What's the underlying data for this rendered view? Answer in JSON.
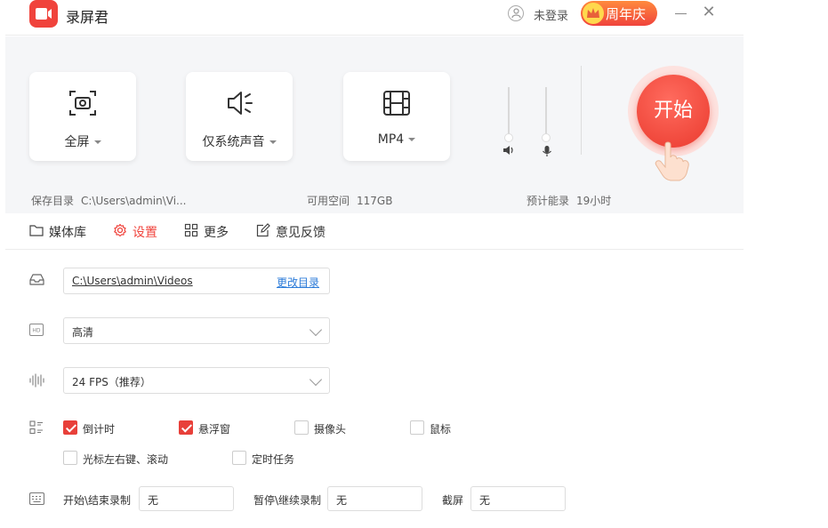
{
  "titlebar": {
    "app_title": "录屏君",
    "user_label": "未登录",
    "anniversary_label": "周年庆"
  },
  "controls": {
    "capture_area": "全屏",
    "audio_source": "仅系统声音",
    "format": "MP4",
    "start_label": "开始"
  },
  "info": {
    "save_dir_label": "保存目录",
    "save_dir_value": "C:\\Users\\admin\\Vi...",
    "free_space_label": "可用空间",
    "free_space_value": "117GB",
    "estimate_label": "预计能录",
    "estimate_value": "19小时"
  },
  "tabs": [
    {
      "label": "媒体库"
    },
    {
      "label": "设置"
    },
    {
      "label": "更多"
    },
    {
      "label": "意见反馈"
    }
  ],
  "settings": {
    "path_value": "C:\\Users\\admin\\Videos",
    "change_dir_label": "更改目录",
    "quality_value": "高清",
    "fps_value": "24 FPS（推荐）",
    "options": [
      {
        "label": "倒计时",
        "checked": true
      },
      {
        "label": "悬浮窗",
        "checked": true
      },
      {
        "label": "摄像头",
        "checked": false
      },
      {
        "label": "鼠标",
        "checked": false
      },
      {
        "label": "光标左右键、滚动",
        "checked": false
      },
      {
        "label": "定时任务",
        "checked": false
      }
    ],
    "hotkeys": [
      {
        "label": "开始\\结束录制",
        "value": "无"
      },
      {
        "label": "暂停\\继续录制",
        "value": "无"
      },
      {
        "label": "截屏",
        "value": "无"
      }
    ]
  },
  "colors": {
    "accent": "#f0433c",
    "link": "#2b7bd9",
    "panel_bg": "#f5f6f8"
  }
}
